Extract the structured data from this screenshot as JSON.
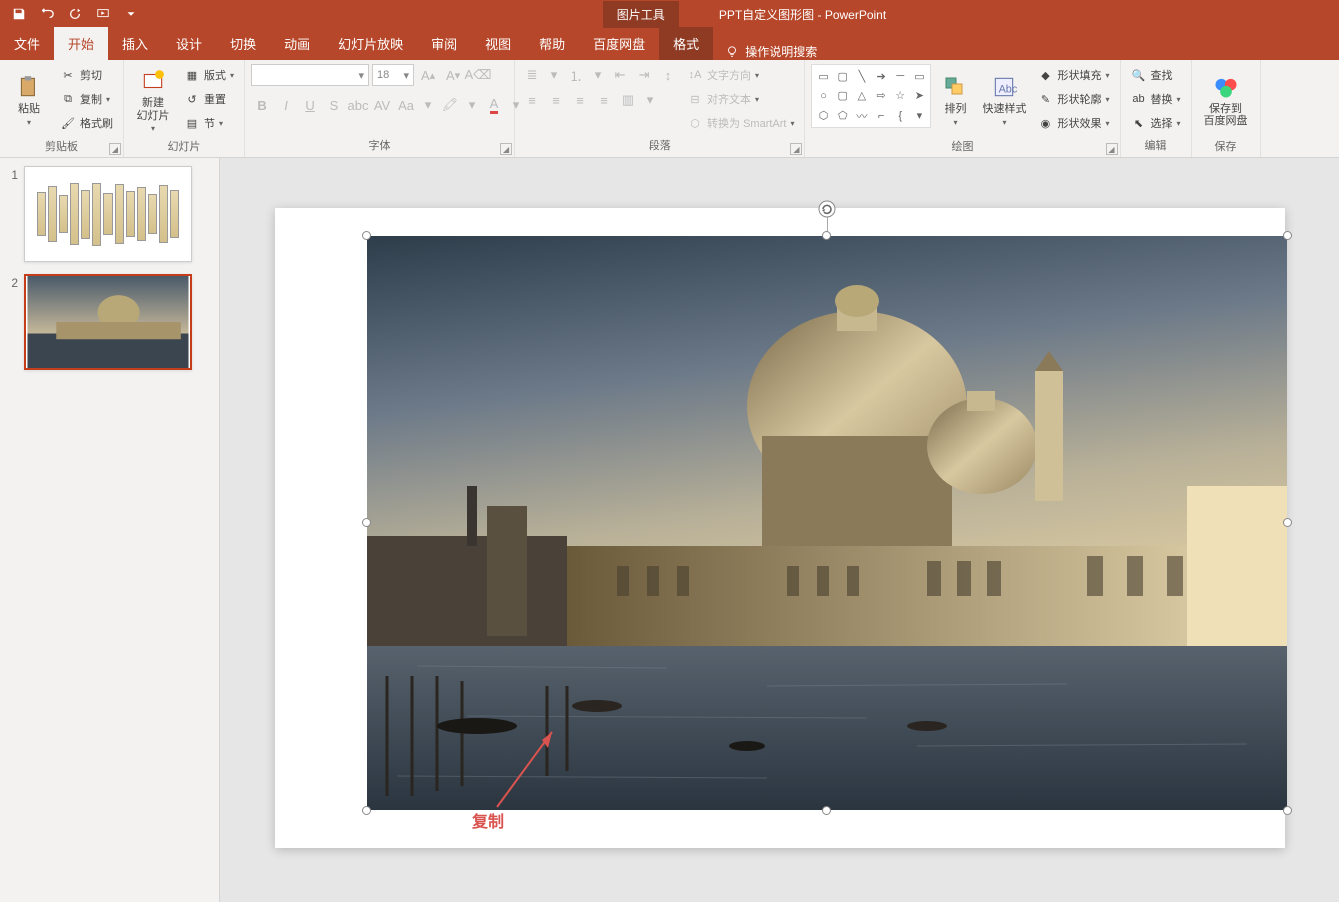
{
  "titlebar": {
    "context_tab": "图片工具",
    "doc_title": "PPT自定义图形图  -  PowerPoint"
  },
  "tabs": {
    "file": "文件",
    "home": "开始",
    "insert": "插入",
    "design": "设计",
    "transitions": "切换",
    "animations": "动画",
    "slideshow": "幻灯片放映",
    "review": "审阅",
    "view": "视图",
    "help": "帮助",
    "baidu": "百度网盘",
    "format": "格式",
    "tell_me": "操作说明搜索"
  },
  "ribbon": {
    "clipboard": {
      "label": "剪贴板",
      "paste": "粘贴",
      "cut": "剪切",
      "copy": "复制",
      "fmt_painter": "格式刷"
    },
    "slides": {
      "label": "幻灯片",
      "new_slide": "新建\n幻灯片",
      "layout": "版式",
      "reset": "重置",
      "section": "节"
    },
    "font": {
      "label": "字体",
      "size": "18"
    },
    "paragraph": {
      "label": "段落",
      "text_dir": "文字方向",
      "align_text": "对齐文本",
      "smartart": "转换为 SmartArt"
    },
    "drawing": {
      "label": "绘图",
      "arrange": "排列",
      "quick_styles": "快速样式",
      "shape_fill": "形状填充",
      "shape_outline": "形状轮廓",
      "shape_effects": "形状效果"
    },
    "editing": {
      "label": "编辑",
      "find": "查找",
      "replace": "替换",
      "select": "选择"
    },
    "save": {
      "label": "保存",
      "save_to": "保存到\n百度网盘"
    }
  },
  "thumbs": {
    "n1": "1",
    "n2": "2"
  },
  "annotation": {
    "copy": "复制"
  }
}
